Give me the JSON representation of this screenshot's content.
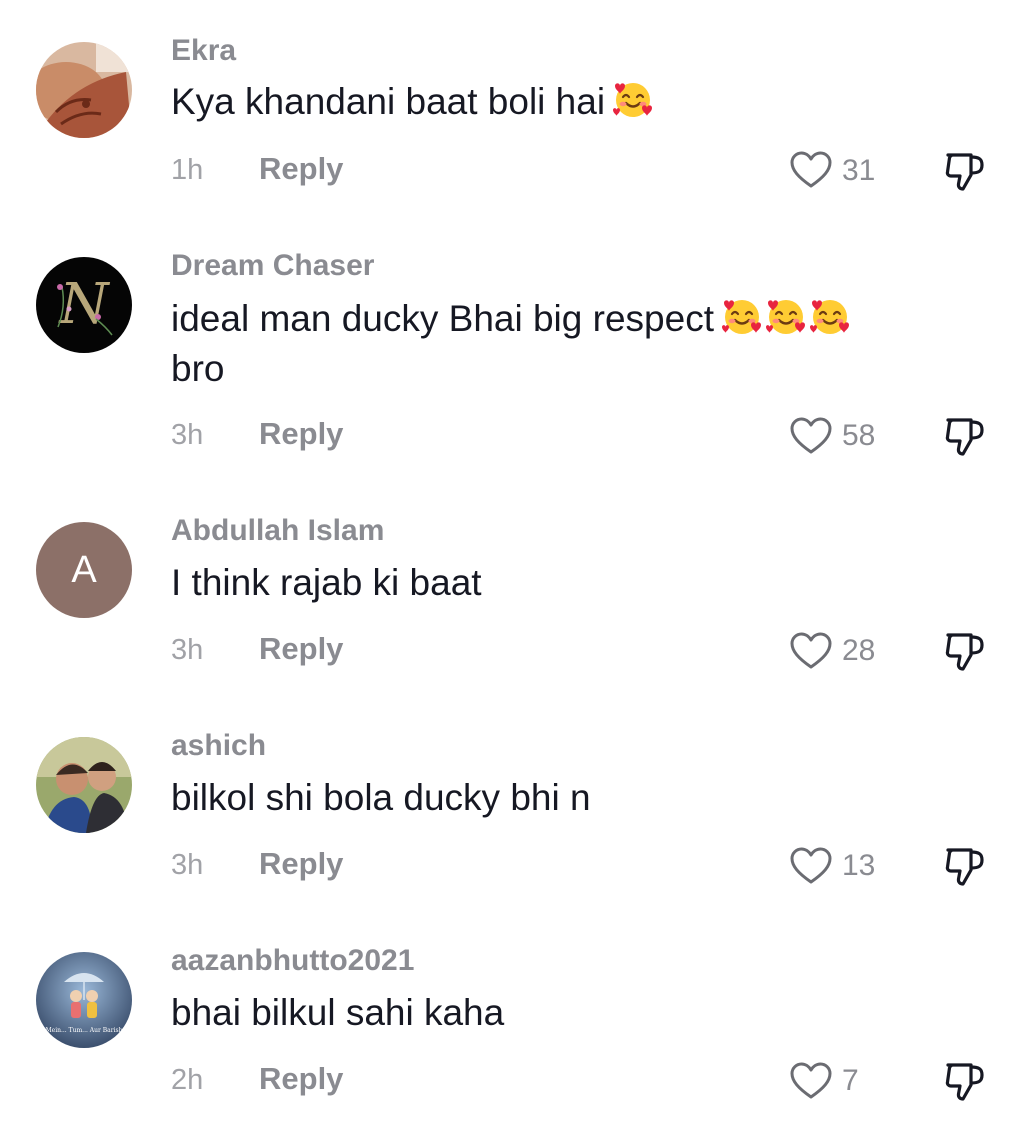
{
  "comments": [
    {
      "username": "Ekra",
      "avatar": "photo-hand-henna",
      "text": "Kya khandani baat boli hai",
      "emojis": [
        "smiling-face-with-hearts"
      ],
      "time": "1h",
      "reply_label": "Reply",
      "likes": "31"
    },
    {
      "username": "Dream Chaser",
      "avatar": "letter-n-floral-dark",
      "text": "ideal man ducky Bhai big respect",
      "emojis": [
        "smiling-face-with-hearts",
        "smiling-face-with-hearts",
        "smiling-face-with-hearts"
      ],
      "text_end": "bro",
      "time": "3h",
      "reply_label": "Reply",
      "likes": "58"
    },
    {
      "username": "Abdullah Islam",
      "avatar_letter": "A",
      "avatar_color": "#8c7068",
      "text": "I think rajab ki baat",
      "time": "3h",
      "reply_label": "Reply",
      "likes": "28"
    },
    {
      "username": "ashich",
      "avatar": "photo-two-children",
      "text": "bilkol shi bola ducky bhi n",
      "time": "3h",
      "reply_label": "Reply",
      "likes": "13"
    },
    {
      "username": "aazanbhutto2021",
      "avatar": "illustration-couple-umbrella",
      "avatar_caption": "Mein... Tum... Aur Barish",
      "text": "bhai bilkul sahi kaha",
      "time": "2h",
      "reply_label": "Reply",
      "likes": "7"
    }
  ],
  "icons": {
    "like": "heart-outline-icon",
    "dislike": "thumbs-down-outline-icon"
  },
  "colors": {
    "username": "#8a8b91",
    "text": "#161823",
    "meta": "#a1a2a7"
  }
}
